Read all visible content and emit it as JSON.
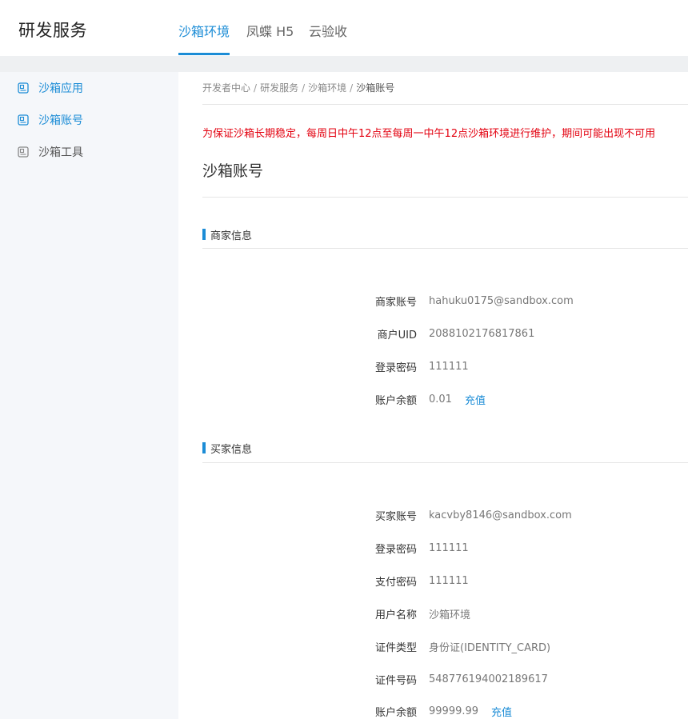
{
  "header": {
    "brand": "研发服务",
    "tabs": [
      "沙箱环境",
      "凤蝶 H5",
      "云验收"
    ]
  },
  "sidebar": {
    "items": [
      {
        "label": "沙箱应用"
      },
      {
        "label": "沙箱账号"
      },
      {
        "label": "沙箱工具"
      }
    ]
  },
  "breadcrumb": [
    "开发者中心",
    "研发服务",
    "沙箱环境",
    "沙箱账号"
  ],
  "notice": "为保证沙箱长期稳定，每周日中午12点至每周一中午12点沙箱环境进行维护，期间可能出现不可用",
  "page_title": "沙箱账号",
  "merchant": {
    "title": "商家信息",
    "rows": [
      {
        "label": "商家账号",
        "value": "hahuku0175@sandbox.com"
      },
      {
        "label": "商户UID",
        "value": "2088102176817861"
      },
      {
        "label": "登录密码",
        "value": "111111"
      },
      {
        "label": "账户余额",
        "value": "0.01",
        "action": "充值"
      }
    ]
  },
  "buyer": {
    "title": "买家信息",
    "rows": [
      {
        "label": "买家账号",
        "value": "kacvby8146@sandbox.com"
      },
      {
        "label": "登录密码",
        "value": "111111"
      },
      {
        "label": "支付密码",
        "value": "111111"
      },
      {
        "label": "用户名称",
        "value": "沙箱环境"
      },
      {
        "label": "证件类型",
        "value": "身份证(IDENTITY_CARD)"
      },
      {
        "label": "证件号码",
        "value": "548776194002189617"
      },
      {
        "label": "账户余额",
        "value": "99999.99",
        "action": "充值"
      }
    ]
  },
  "colors": {
    "accent": "#1b8cd6",
    "notice": "#e3000f"
  }
}
